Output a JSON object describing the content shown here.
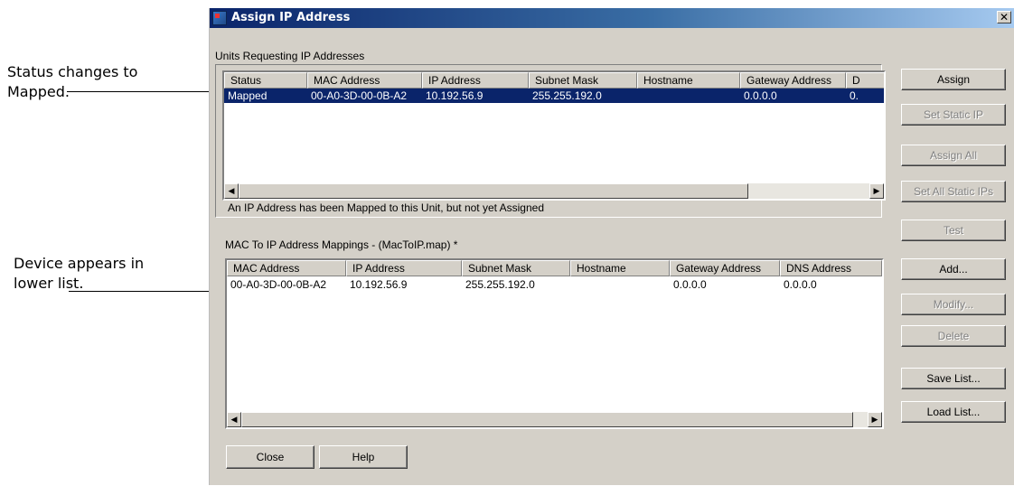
{
  "callouts": {
    "status_line1": "Status changes to",
    "status_line2": "Mapped.",
    "device_line1": "Device appears in",
    "device_line2": "lower list."
  },
  "window": {
    "title": "Assign IP Address",
    "close_glyph": "✕"
  },
  "upper": {
    "group_label": "Units Requesting IP Addresses",
    "columns": [
      "Status",
      "MAC Address",
      "IP Address",
      "Subnet Mask",
      "Hostname",
      "Gateway Address",
      "D"
    ],
    "rows": [
      [
        "Mapped",
        "00-A0-3D-00-0B-A2",
        "10.192.56.9",
        "255.255.192.0",
        "",
        "0.0.0.0",
        "0."
      ]
    ],
    "status_text": "An IP Address has been Mapped to this Unit, but not yet Assigned"
  },
  "lower": {
    "group_label": "MAC To IP Address Mappings - (MacToIP.map) *",
    "columns": [
      "MAC Address",
      "IP Address",
      "Subnet Mask",
      "Hostname",
      "Gateway Address",
      "DNS Address"
    ],
    "rows": [
      [
        "00-A0-3D-00-0B-A2",
        "10.192.56.9",
        "255.255.192.0",
        "",
        "0.0.0.0",
        "0.0.0.0"
      ]
    ]
  },
  "buttons": {
    "assign": "Assign",
    "set_static_ip": "Set Static IP",
    "assign_all": "Assign All",
    "set_all_static_ips": "Set All Static IPs",
    "test": "Test",
    "add": "Add...",
    "modify": "Modify...",
    "delete": "Delete",
    "save_list": "Save List...",
    "load_list": "Load List...",
    "close": "Close",
    "help": "Help"
  },
  "scroll_arrows": {
    "left": "◀",
    "right": "▶"
  }
}
